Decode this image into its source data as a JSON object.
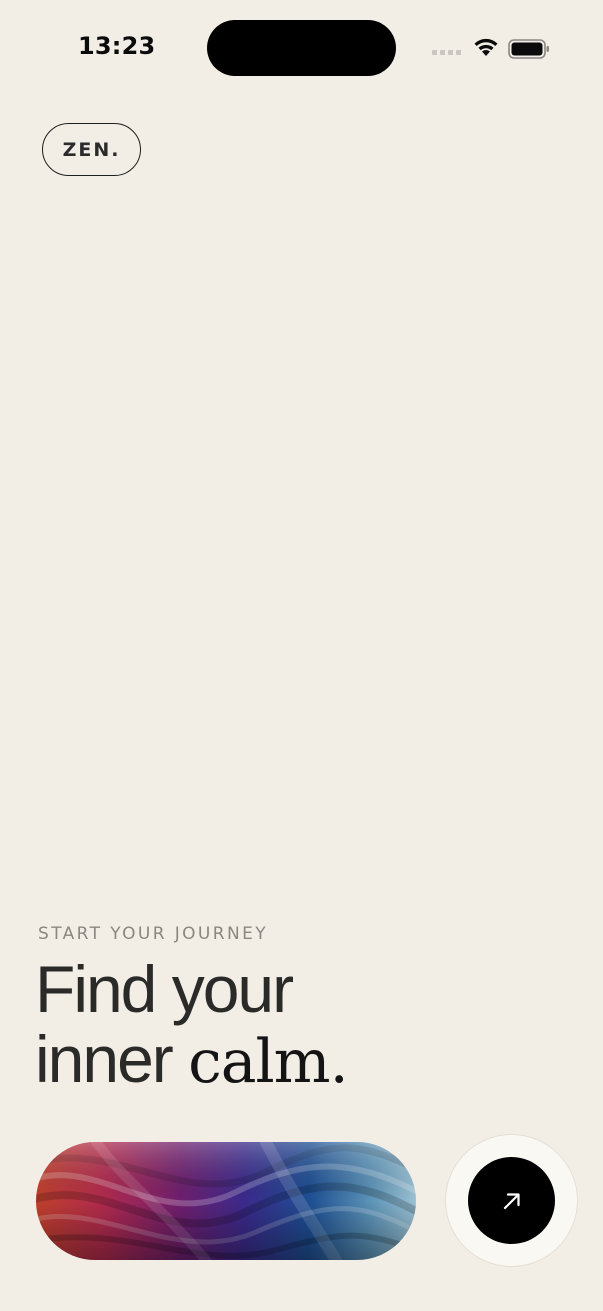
{
  "status_bar": {
    "time": "13:23",
    "icons": [
      "signal-icon",
      "wifi-icon",
      "battery-icon"
    ]
  },
  "brand": {
    "label": "ZEN."
  },
  "hero": {
    "eyebrow": "START YOUR JOURNEY",
    "line1": "Find your",
    "line2_prefix": "inner ",
    "line2_accent": "calm."
  },
  "cta": {
    "icon": "arrow-up-right-icon"
  },
  "colors": {
    "background": "#F2EEE6",
    "text": "#151515",
    "muted": "#8A8780",
    "button": "#000000",
    "ring": "#FAF8F3"
  }
}
